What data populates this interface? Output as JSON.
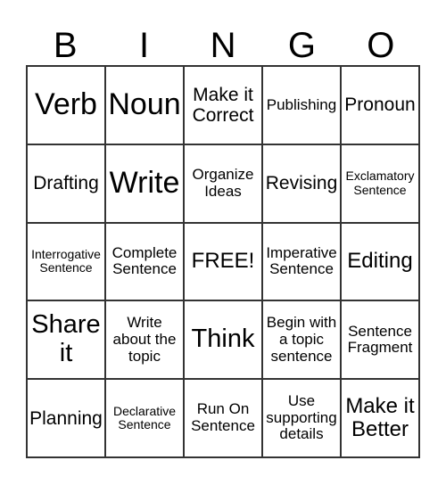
{
  "header": [
    "B",
    "I",
    "N",
    "G",
    "O"
  ],
  "cells": [
    {
      "text": "Verb",
      "size": "s36"
    },
    {
      "text": "Noun",
      "size": "s36"
    },
    {
      "text": "Make it Correct",
      "size": "s22"
    },
    {
      "text": "Publishing",
      "size": "s18"
    },
    {
      "text": "Pronoun",
      "size": "s22"
    },
    {
      "text": "Drafting",
      "size": "s22"
    },
    {
      "text": "Write",
      "size": "s36"
    },
    {
      "text": "Organize Ideas",
      "size": "s18"
    },
    {
      "text": "Revising",
      "size": "s22"
    },
    {
      "text": "Exclamatory Sentence",
      "size": "s14"
    },
    {
      "text": "Interrogative Sentence",
      "size": "s14"
    },
    {
      "text": "Complete Sentence",
      "size": "s18"
    },
    {
      "text": "FREE!",
      "size": "s24"
    },
    {
      "text": "Imperative Sentence",
      "size": "s18"
    },
    {
      "text": "Editing",
      "size": "s24"
    },
    {
      "text": "Share it",
      "size": "s30"
    },
    {
      "text": "Write about the topic",
      "size": "s18"
    },
    {
      "text": "Think",
      "size": "s30"
    },
    {
      "text": "Begin with a topic sentence",
      "size": "s18"
    },
    {
      "text": "Sentence Fragment",
      "size": "s18"
    },
    {
      "text": "Planning",
      "size": "s22"
    },
    {
      "text": "Declarative Sentence",
      "size": "s14"
    },
    {
      "text": "Run On Sentence",
      "size": "s18"
    },
    {
      "text": "Use supporting details",
      "size": "s18"
    },
    {
      "text": "Make it Better",
      "size": "s24"
    }
  ]
}
